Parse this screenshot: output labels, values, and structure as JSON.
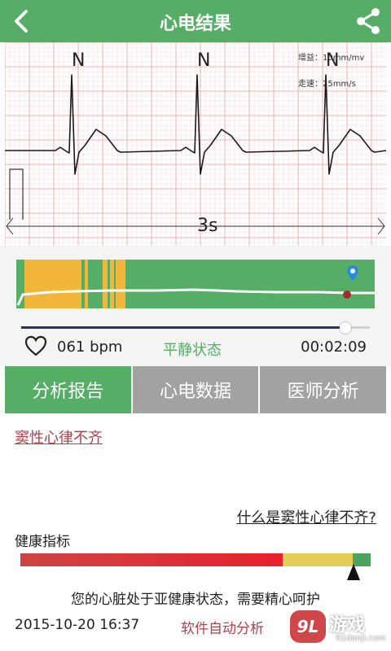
{
  "header": {
    "title": "心电结果",
    "back_icon": "back-arrow-icon",
    "share_icon": "share-icon"
  },
  "ecg": {
    "beat_labels": [
      "N",
      "N",
      "N"
    ],
    "gain_label": "增益：10mm/mv",
    "speed_label": "走速：25mm/s",
    "time_span": "3s",
    "grid_color": "#f0a8a8"
  },
  "trend": {
    "colors": {
      "normal": "#56ad66",
      "warning": "#f2b63a",
      "line": "#ffffff",
      "marker": "#2a8bd8"
    }
  },
  "stats": {
    "heart_icon": "heart-icon",
    "bpm": "061 bpm",
    "state": "平静状态",
    "time": "00:02:09"
  },
  "tabs": [
    {
      "label": "分析报告",
      "active": true
    },
    {
      "label": "心电数据",
      "active": false
    },
    {
      "label": "医师分析",
      "active": false
    }
  ],
  "report": {
    "diagnosis": "窦性心律不齐",
    "what_link": "什么是窦性心律不齐?",
    "health_title": "健康指标",
    "health_level": 0.95,
    "advice": "您的心脏处于亚健康状态，需要精心呵护",
    "date": "2015-10-20 16:37",
    "source": "软件自动分析"
  },
  "watermark": {
    "badge": "9L",
    "text": "游戏",
    "sub": "91danji.com"
  }
}
